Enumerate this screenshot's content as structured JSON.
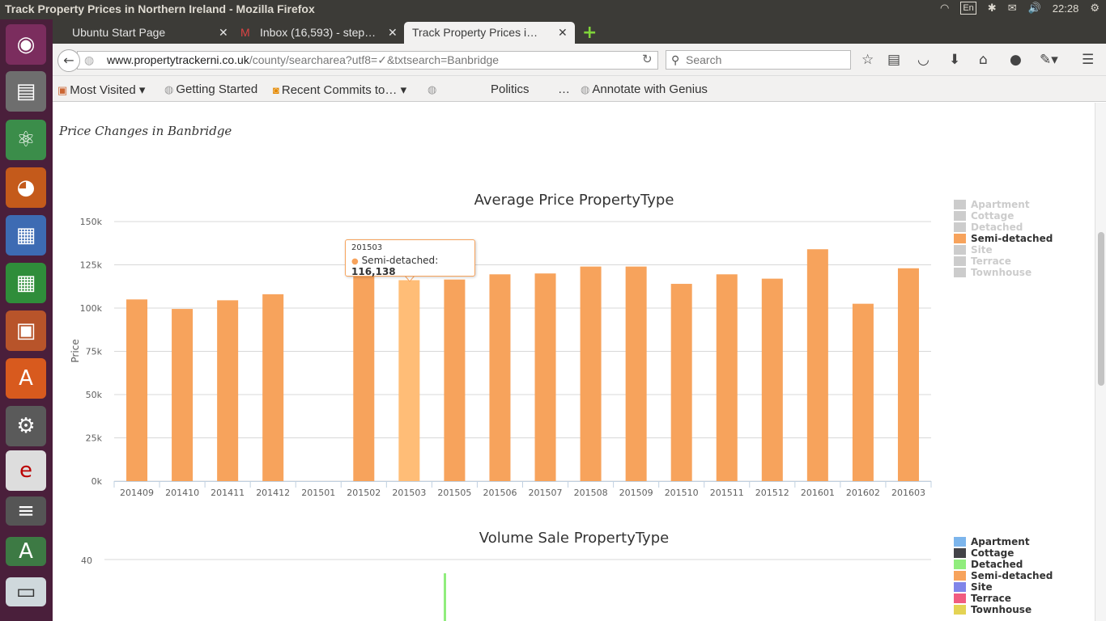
{
  "window": {
    "title": "Track Property Prices in Northern Ireland - Mozilla Firefox"
  },
  "tray": {
    "keyboard": "En",
    "clock": "22:28"
  },
  "tabs": [
    {
      "label": "Ubuntu Start Page"
    },
    {
      "label": "Inbox (16,593) - step…"
    },
    {
      "label": "Track Property Prices i…"
    }
  ],
  "url": {
    "host": "www.propertytrackerni.co.uk",
    "path": "/county/searcharea?utf8=✓&txtsearch=Banbridge"
  },
  "search": {
    "placeholder": "Search"
  },
  "bookmarks": [
    {
      "label": "Most Visited"
    },
    {
      "label": "Getting Started"
    },
    {
      "label": "Recent Commits to…"
    },
    {
      "label": "Politics"
    },
    {
      "label": "…"
    },
    {
      "label": "Annotate with Genius"
    }
  ],
  "page": {
    "title": "Price Changes in Banbridge"
  },
  "colors": {
    "Apartment": "#7cb5ec",
    "Cottage": "#434348",
    "Detached": "#90ed7d",
    "Semi-detached": "#f7a35c",
    "Site": "#8085e9",
    "Terrace": "#f15c80",
    "Townhouse": "#e4d354",
    "legend_hidden": "#cccccc",
    "bar_hover": "#ffbd77"
  },
  "chart_data": [
    {
      "type": "bar",
      "title": "Average Price PropertyType",
      "ylabel": "Price",
      "xlabel": "",
      "ylim": [
        0,
        150000
      ],
      "yticks": [
        "0k",
        "25k",
        "50k",
        "75k",
        "100k",
        "125k",
        "150k"
      ],
      "grid": true,
      "legend_position": "right",
      "categories": [
        "201409",
        "201410",
        "201411",
        "201412",
        "201501",
        "201502",
        "201503",
        "201505",
        "201506",
        "201507",
        "201508",
        "201509",
        "201510",
        "201511",
        "201512",
        "201601",
        "201602",
        "201603"
      ],
      "series": [
        {
          "name": "Apartment",
          "visible": false
        },
        {
          "name": "Cottage",
          "visible": false
        },
        {
          "name": "Detached",
          "visible": false
        },
        {
          "name": "Semi-detached",
          "visible": true,
          "values": [
            105000,
            99500,
            104500,
            108000,
            null,
            121000,
            116138,
            116500,
            119500,
            120000,
            124000,
            124000,
            114000,
            119500,
            117000,
            134000,
            102500,
            123000
          ]
        },
        {
          "name": "Site",
          "visible": false
        },
        {
          "name": "Terrace",
          "visible": false
        },
        {
          "name": "Townhouse",
          "visible": false
        }
      ],
      "tooltip": {
        "category": "201503",
        "series": "Semi-detached",
        "value": "116,138"
      }
    },
    {
      "type": "bar",
      "title": "Volume Sale PropertyType",
      "ylabel": "",
      "xlabel": "",
      "yticks": [
        "40"
      ],
      "grid": true,
      "legend_position": "right",
      "series": [
        {
          "name": "Apartment",
          "visible": true
        },
        {
          "name": "Cottage",
          "visible": true
        },
        {
          "name": "Detached",
          "visible": true
        },
        {
          "name": "Semi-detached",
          "visible": true
        },
        {
          "name": "Site",
          "visible": true
        },
        {
          "name": "Terrace",
          "visible": true
        },
        {
          "name": "Townhouse",
          "visible": true
        }
      ]
    }
  ]
}
